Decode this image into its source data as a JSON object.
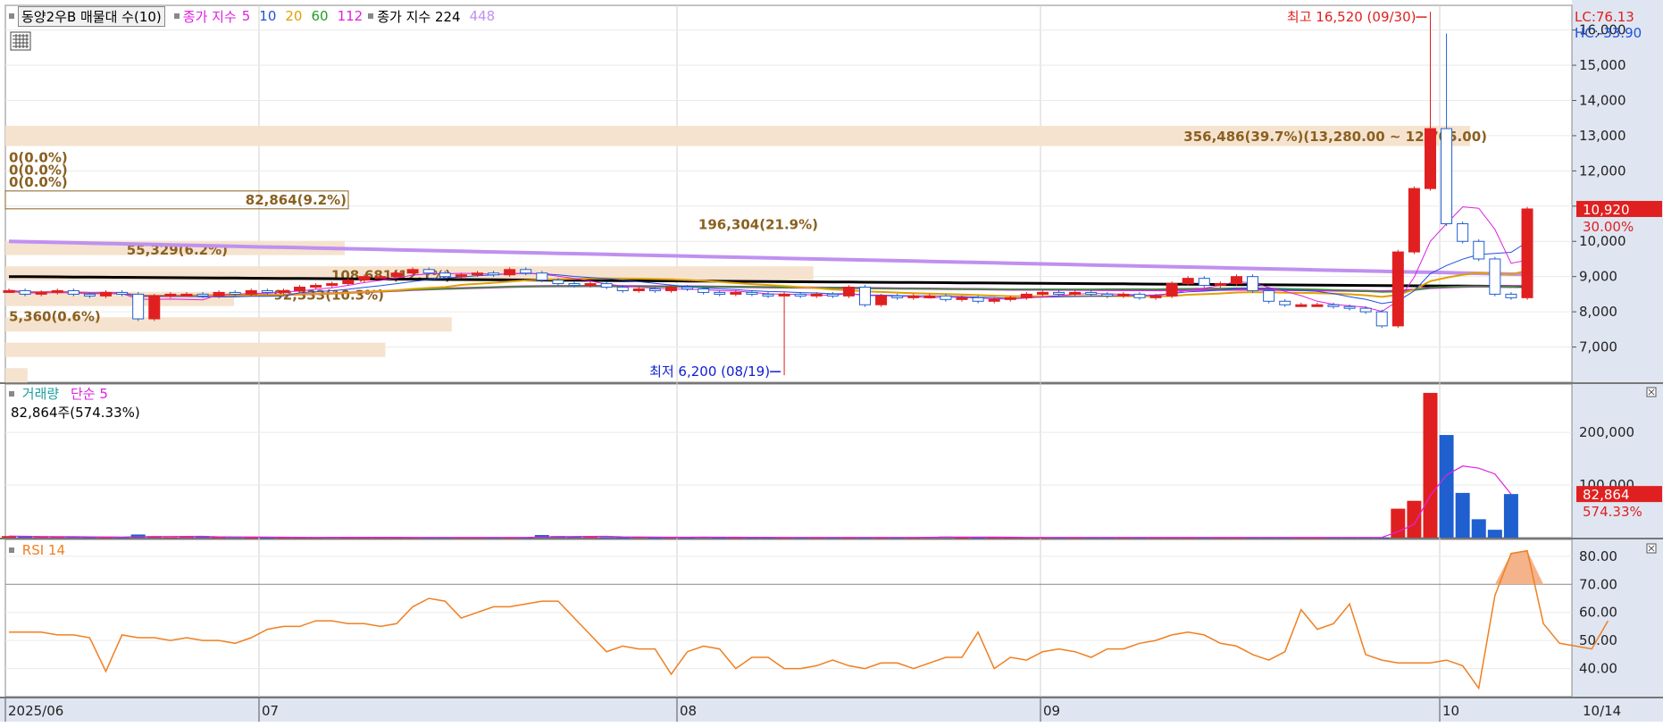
{
  "header": {
    "stock_title": "동양2우B 매물대 수(10)",
    "ma_label": "종가 지수",
    "ma_periods": [
      {
        "label": "5",
        "color": "#e020e0"
      },
      {
        "label": "10",
        "color": "#2050e0"
      },
      {
        "label": "20",
        "color": "#e0a000"
      },
      {
        "label": "60",
        "color": "#20a020"
      },
      {
        "label": "112",
        "color": "#e020e0"
      }
    ],
    "ma2_label": "종가 지수 224",
    "ma2_extra": {
      "label": "448",
      "color": "#c090f0"
    }
  },
  "price_axis": {
    "lc_label": "LC:76.13",
    "hc_label": "HC:-33.90",
    "ticks": [
      "16,000",
      "15,000",
      "14,000",
      "13,000",
      "12,000",
      "11,000",
      "10,000",
      "9,000",
      "8,000",
      "7,000"
    ],
    "current_price": "10,920",
    "current_change": "30.00%"
  },
  "annotations": {
    "high": "최고 16,520 (09/30)",
    "low": "최저 6,200 (08/19)"
  },
  "volume_profile": [
    {
      "label": "356,486(39.7%)(13,280.00 ~ 12,705.00)",
      "share": 0.397
    },
    {
      "label": "0(0.0%)",
      "share": 0.0
    },
    {
      "label": "0(0.0%)",
      "share": 0.0
    },
    {
      "label": "0(0.0%)",
      "share": 0.0
    },
    {
      "label": "82,864(9.2%)",
      "share": 0.092
    },
    {
      "label": "196,304(21.9%)",
      "share": 0.219
    },
    {
      "label": "55,329(6.2%)",
      "share": 0.062
    },
    {
      "label": "108,681(12.1%)",
      "share": 0.121
    },
    {
      "label": "92,333(10.3%)",
      "share": 0.103
    },
    {
      "label": "5,360(0.6%)",
      "share": 0.006
    }
  ],
  "volume_pane": {
    "label_main": "거래량",
    "label_ma": "단순 5",
    "info": "82,864주(574.33%)",
    "ticks": [
      "200,000",
      "100,000"
    ],
    "current_value": "82,864",
    "current_change": "574.33%"
  },
  "rsi_pane": {
    "label": "RSI 14",
    "ticks": [
      "80.00",
      "70.00",
      "60.00",
      "50.00",
      "40.00"
    ]
  },
  "x_axis": {
    "labels": [
      "2025/06",
      "07",
      "08",
      "09",
      "10"
    ],
    "end_label": "10/14"
  },
  "colors": {
    "up": "#e02020",
    "down": "#2060d0",
    "ma5": "#e020e0",
    "ma10": "#2050e0",
    "ma20": "#e0a000",
    "ma60": "#20a020",
    "ma112": "#e020e0",
    "ma224": "#000000",
    "ma448": "#c090f0",
    "rsi": "#f07f20",
    "profile": "#f5e3cf",
    "profile_text": "#8a6020"
  },
  "chart_data": [
    {
      "type": "candlestick",
      "title": "동양2우B",
      "x_start": "2025/06",
      "x_end": "10/14",
      "ylim": [
        6000,
        16700
      ],
      "high": {
        "value": 16520,
        "date": "09/30"
      },
      "low": {
        "value": 6200,
        "date": "08/19"
      },
      "last_close": 10920,
      "last_change_pct": 30.0,
      "closes": [
        8600,
        8500,
        8550,
        8600,
        8500,
        8450,
        8550,
        8500,
        7800,
        8450,
        8500,
        8500,
        8450,
        8550,
        8500,
        8600,
        8550,
        8600,
        8700,
        8750,
        8800,
        8900,
        9000,
        9000,
        9100,
        9200,
        9100,
        9000,
        9050,
        9100,
        9050,
        9200,
        9100,
        8900,
        8800,
        8750,
        8800,
        8700,
        8600,
        8650,
        8600,
        8700,
        8650,
        8550,
        8500,
        8550,
        8500,
        8450,
        8500,
        8450,
        8500,
        8450,
        8700,
        8200,
        8450,
        8400,
        8450,
        8450,
        8350,
        8400,
        8300,
        8350,
        8400,
        8500,
        8550,
        8500,
        8550,
        8500,
        8450,
        8500,
        8400,
        8450,
        8800,
        8950,
        8750,
        8800,
        9000,
        8600,
        8300,
        8200,
        8200,
        8200,
        8150,
        8100,
        8000,
        7600,
        9700,
        11500,
        13200,
        10500,
        10000,
        9500,
        8500,
        8400,
        10920
      ],
      "volume_profile_shares": [
        0.397,
        0.0,
        0.0,
        0.0,
        0.092,
        0.219,
        0.062,
        0.121,
        0.103,
        0.006
      ]
    },
    {
      "type": "bar",
      "title": "거래량",
      "last_value": 82864,
      "last_change_pct": 574.33,
      "ylim": [
        0,
        285000
      ],
      "values": [
        3000,
        2000,
        1500,
        1500,
        1500,
        1000,
        1000,
        1000,
        6000,
        2000,
        1000,
        1500,
        2000,
        1000,
        1500,
        500,
        500,
        500,
        500,
        500,
        1500,
        500,
        500,
        500,
        500,
        500,
        500,
        500,
        500,
        500,
        500,
        500,
        500,
        5000,
        3000,
        2000,
        1500,
        1000,
        500,
        1500,
        500,
        1000,
        500,
        1500,
        500,
        500,
        500,
        500,
        500,
        500,
        500,
        500,
        500,
        500,
        500,
        500,
        500,
        1500,
        2000,
        500,
        500,
        500,
        500,
        500,
        500,
        500,
        500,
        500,
        500,
        500,
        500,
        500,
        500,
        500,
        500,
        500,
        500,
        500,
        500,
        500,
        500,
        500,
        500,
        500,
        500,
        500,
        55000,
        70000,
        275000,
        195000,
        85000,
        35000,
        15000,
        82864
      ],
      "ma_period": 5
    },
    {
      "type": "line",
      "title": "RSI 14",
      "ylim": [
        30,
        86
      ],
      "hline": 70,
      "values": [
        53,
        53,
        53,
        52,
        52,
        51,
        39,
        52,
        51,
        51,
        50,
        51,
        50,
        50,
        49,
        51,
        54,
        55,
        55,
        57,
        57,
        56,
        56,
        55,
        56,
        62,
        65,
        64,
        58,
        60,
        62,
        62,
        63,
        64,
        64,
        58,
        52,
        46,
        48,
        47,
        47,
        38,
        46,
        48,
        47,
        40,
        44,
        44,
        40,
        40,
        41,
        43,
        41,
        40,
        42,
        42,
        40,
        42,
        44,
        44,
        53,
        40,
        44,
        43,
        46,
        47,
        46,
        44,
        47,
        47,
        49,
        50,
        52,
        53,
        52,
        49,
        48,
        45,
        43,
        46,
        61,
        54,
        56,
        63,
        45,
        43,
        42,
        42,
        42,
        43,
        41,
        33,
        66,
        81,
        82,
        56,
        49,
        48,
        47,
        57
      ]
    }
  ]
}
